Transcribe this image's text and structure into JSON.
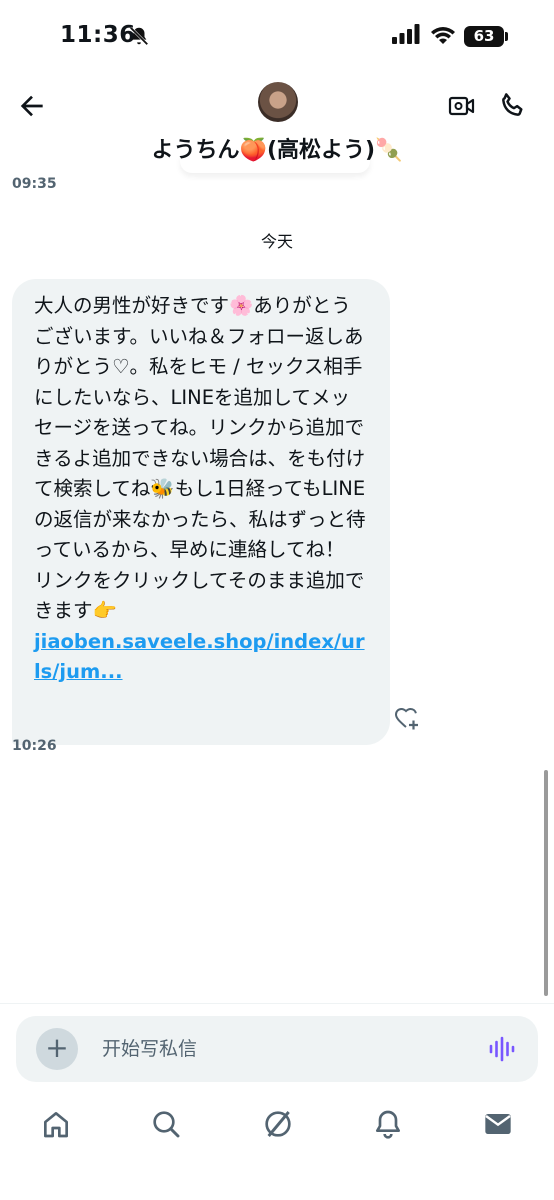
{
  "status_bar": {
    "time": "11:36",
    "battery": "63"
  },
  "conversation": {
    "contact_name": "ようちん🍑(高松よう)🍡"
  },
  "timestamps": {
    "top": "09:35",
    "bottom": "10:26"
  },
  "day_separator": "今天",
  "message": {
    "text": "大人の男性が好きです🌸ありがとうございます。いいね＆フォロー返しありがとう♡。私をヒモ / セックス相手にしたいなら、LINEを追加してメッセージを送ってね。リンクから追加できるよ追加できない場合は、をも付けて検索してね🐝もし1日経ってもLINEの返信が来なかったら、私はずっと待っているから、早めに連絡してね！ リンクをクリックしてそのまま追加できます👉",
    "link": "jiaoben.saveele.shop/index/urls/jum..."
  },
  "composer": {
    "placeholder": "开始写私信"
  },
  "icons": {
    "back": "arrow-left-icon",
    "video": "video-call-icon",
    "phone": "phone-icon",
    "react": "heart-plus-icon",
    "add": "plus-icon",
    "voice": "voice-wave-icon",
    "nav": [
      "home-icon",
      "search-icon",
      "grok-icon",
      "notifications-icon",
      "messages-icon"
    ]
  },
  "colors": {
    "accent": "#1d9bf0",
    "bubble": "#eff3f4",
    "voice": "#7856ff"
  }
}
